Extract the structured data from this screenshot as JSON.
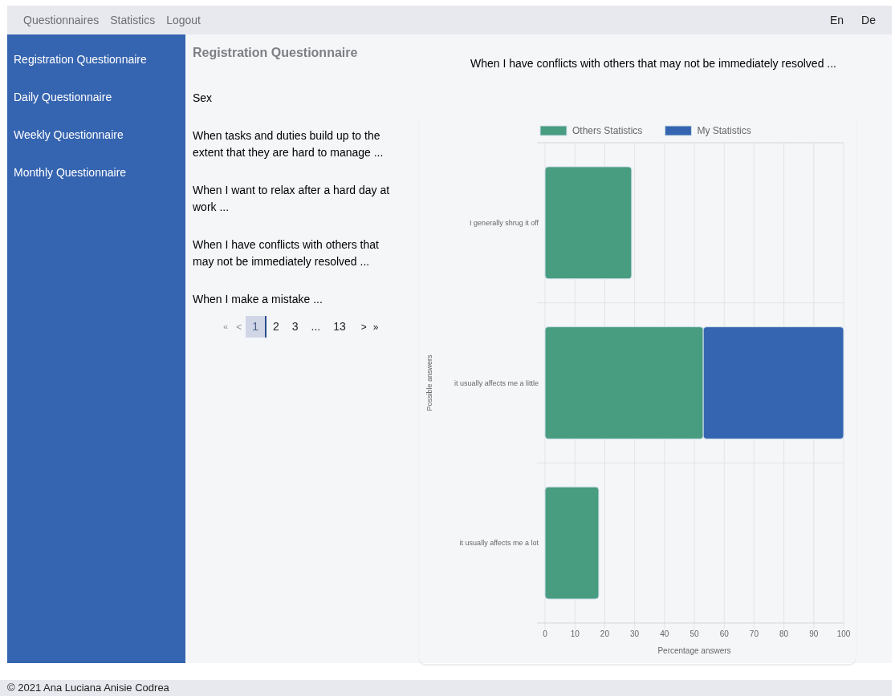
{
  "nav": {
    "links": [
      "Questionnaires",
      "Statistics",
      "Logout"
    ],
    "languages": [
      "En",
      "De"
    ]
  },
  "sidebar": {
    "items": [
      "Registration Questionnaire",
      "Daily Questionnaire",
      "Weekly Questionnaire",
      "Monthly Questionnaire"
    ]
  },
  "questions": {
    "title": "Registration Questionnaire",
    "items": [
      "Sex",
      "When tasks and duties build up to the extent that they are hard to manage ...",
      "When I want to relax after a hard day at work ...",
      "When I have conflicts with others that may not be immediately resolved ...",
      "When I make a mistake ..."
    ],
    "pagination": {
      "first": "«",
      "prev": "<",
      "pages": [
        {
          "label": "1",
          "selected": true
        },
        {
          "label": "2",
          "selected": false
        },
        {
          "label": "3",
          "selected": false
        },
        {
          "label": "...",
          "selected": false
        },
        {
          "label": "13",
          "selected": false
        }
      ],
      "next": ">",
      "last": "»"
    }
  },
  "statistics": {
    "question": "When I have conflicts with others that may not be immediately resolved ...",
    "chart_data": {
      "type": "bar",
      "orientation": "horizontal",
      "stacked": true,
      "xlabel": "Percentage answers",
      "ylabel": "Possible answers",
      "categories": [
        "I generally shrug it off",
        "it usually affects me a little",
        "it usually affects me a lot"
      ],
      "series": [
        {
          "name": "Others Statistics",
          "color": "#489c80",
          "values": [
            29,
            53,
            18
          ]
        },
        {
          "name": "My Statistics",
          "color": "#3564b0",
          "values": [
            0,
            47,
            0
          ]
        }
      ],
      "grid": true,
      "legend": "top",
      "xlim": [
        0,
        100
      ],
      "xticks": [
        0,
        10,
        20,
        30,
        40,
        50,
        60,
        70,
        80,
        90,
        100
      ]
    }
  },
  "footer": "© 2021 Ana Luciana Anisie Codrea"
}
